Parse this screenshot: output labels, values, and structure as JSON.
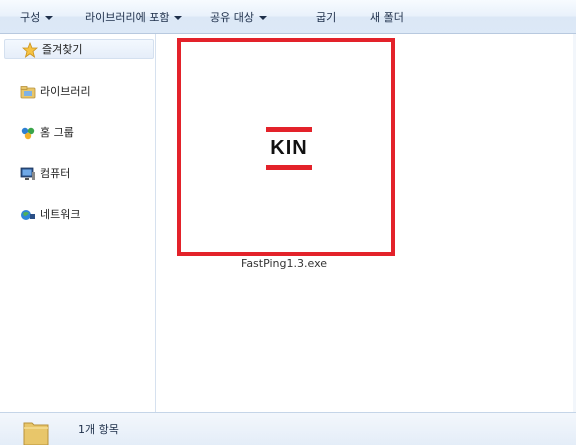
{
  "toolbar": {
    "organize": "구성",
    "include_in_library": "라이브러리에 포함",
    "share_with": "공유 대상",
    "burn": "굽기",
    "new_folder": "새 폴더"
  },
  "nav": {
    "favorites": "즐겨찾기",
    "libraries": "라이브러리",
    "homegroup": "홈 그룹",
    "computer": "컴퓨터",
    "network": "네트워크"
  },
  "file": {
    "name": "FastPing1.3.exe",
    "logo_text": "KIN"
  },
  "status": {
    "item_count": "1개 항목"
  },
  "colors": {
    "highlight": "#e3222a",
    "toolbar_text": "#1e2f4a"
  }
}
